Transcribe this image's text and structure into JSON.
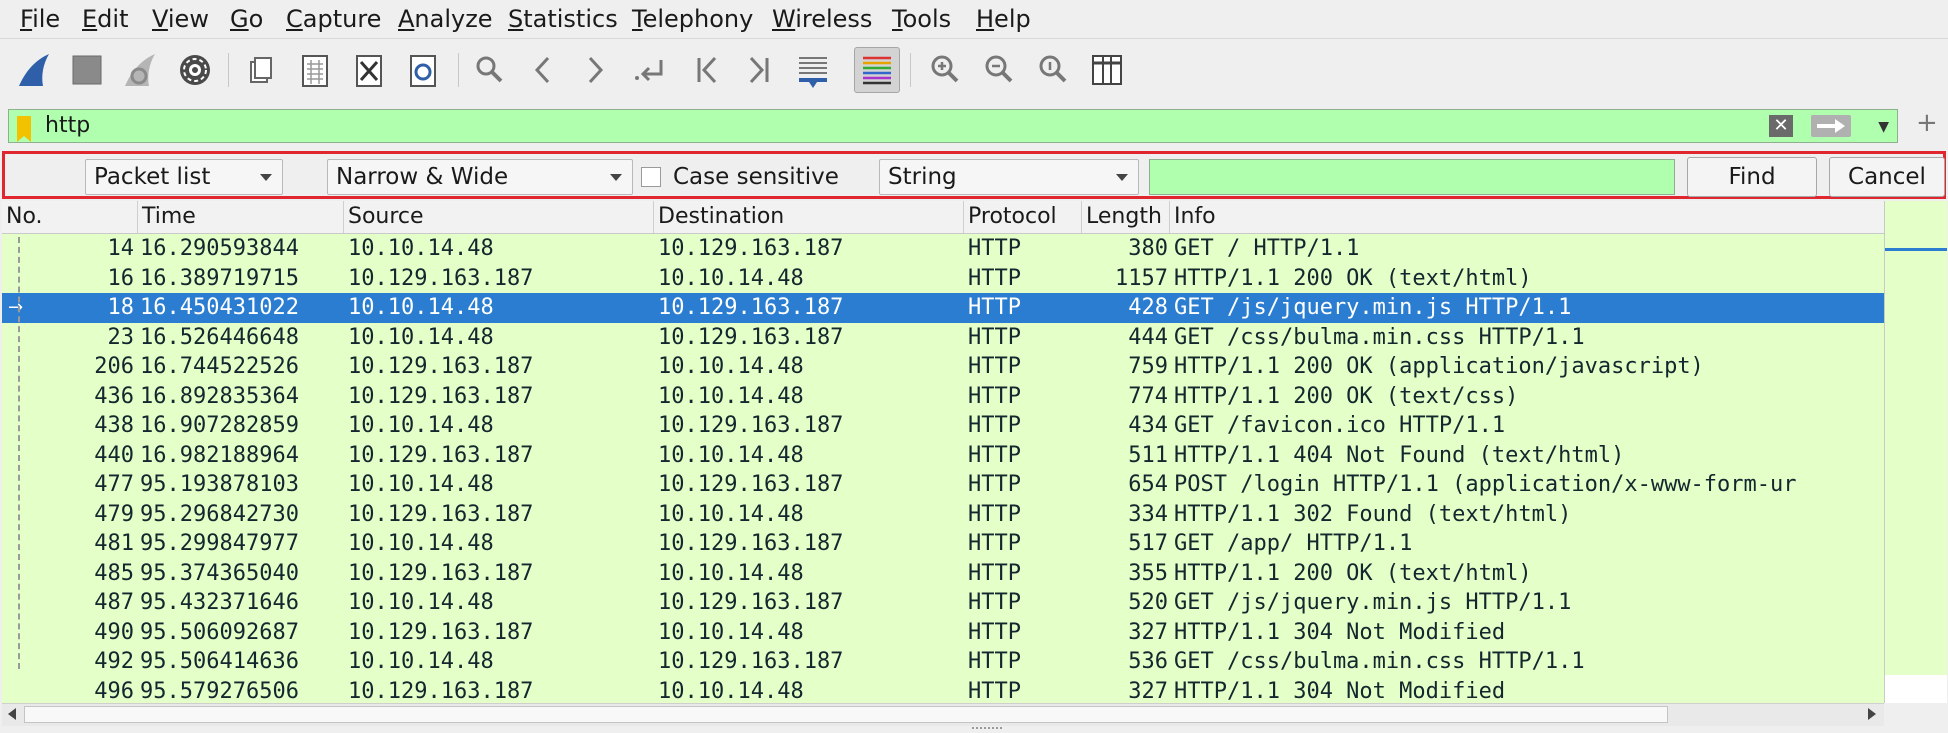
{
  "menu": [
    "File",
    "Edit",
    "View",
    "Go",
    "Capture",
    "Analyze",
    "Statistics",
    "Telephony",
    "Wireless",
    "Tools",
    "Help"
  ],
  "menu_mnemonic": [
    "F",
    "E",
    "V",
    "G",
    "C",
    "A",
    "S",
    "T",
    "W",
    "T",
    "H"
  ],
  "toolbar": [
    {
      "icon": "shark-fin-start-icon"
    },
    {
      "icon": "stop-capture-icon"
    },
    {
      "icon": "restart-capture-icon"
    },
    {
      "icon": "capture-options-gear-icon"
    },
    {
      "icon": "open-file-icon"
    },
    {
      "icon": "save-file-icon"
    },
    {
      "icon": "close-file-icon"
    },
    {
      "icon": "reload-file-icon"
    },
    {
      "icon": "find-packet-icon"
    },
    {
      "icon": "go-back-icon"
    },
    {
      "icon": "go-forward-icon"
    },
    {
      "icon": "go-to-packet-icon"
    },
    {
      "icon": "first-packet-icon"
    },
    {
      "icon": "last-packet-icon"
    },
    {
      "icon": "autoscroll-icon"
    },
    {
      "icon": "colorize-icon"
    },
    {
      "icon": "zoom-in-icon"
    },
    {
      "icon": "zoom-out-icon"
    },
    {
      "icon": "zoom-normal-icon"
    },
    {
      "icon": "resize-columns-icon"
    }
  ],
  "display_filter": {
    "value": "http",
    "clear_icon": "✕"
  },
  "find_bar": {
    "search_in": "Packet list",
    "char_width": "Narrow & Wide",
    "case_sensitive_label": "Case sensitive",
    "case_sensitive_checked": false,
    "search_type": "String",
    "search_value": "",
    "find_label": "Find",
    "cancel_label": "Cancel"
  },
  "columns": [
    "No.",
    "Time",
    "Source",
    "Destination",
    "Protocol",
    "Length",
    "Info"
  ],
  "selected_row": 2,
  "colors": {
    "row_bg": "#e4ffc7",
    "selected": "#2a7dd0",
    "filter_ok": "#afffaf",
    "find_border": "#e0262f"
  },
  "rows": [
    {
      "no": "14",
      "time": "16.290593844",
      "src": "10.10.14.48",
      "dst": "10.129.163.187",
      "proto": "HTTP",
      "len": "380",
      "info": "GET / HTTP/1.1"
    },
    {
      "no": "16",
      "time": "16.389719715",
      "src": "10.129.163.187",
      "dst": "10.10.14.48",
      "proto": "HTTP",
      "len": "1157",
      "info": "HTTP/1.1 200 OK  (text/html)"
    },
    {
      "no": "18",
      "time": "16.450431022",
      "src": "10.10.14.48",
      "dst": "10.129.163.187",
      "proto": "HTTP",
      "len": "428",
      "info": "GET /js/jquery.min.js HTTP/1.1"
    },
    {
      "no": "23",
      "time": "16.526446648",
      "src": "10.10.14.48",
      "dst": "10.129.163.187",
      "proto": "HTTP",
      "len": "444",
      "info": "GET /css/bulma.min.css HTTP/1.1"
    },
    {
      "no": "206",
      "time": "16.744522526",
      "src": "10.129.163.187",
      "dst": "10.10.14.48",
      "proto": "HTTP",
      "len": "759",
      "info": "HTTP/1.1 200 OK  (application/javascript)"
    },
    {
      "no": "436",
      "time": "16.892835364",
      "src": "10.129.163.187",
      "dst": "10.10.14.48",
      "proto": "HTTP",
      "len": "774",
      "info": "HTTP/1.1 200 OK  (text/css)"
    },
    {
      "no": "438",
      "time": "16.907282859",
      "src": "10.10.14.48",
      "dst": "10.129.163.187",
      "proto": "HTTP",
      "len": "434",
      "info": "GET /favicon.ico HTTP/1.1"
    },
    {
      "no": "440",
      "time": "16.982188964",
      "src": "10.129.163.187",
      "dst": "10.10.14.48",
      "proto": "HTTP",
      "len": "511",
      "info": "HTTP/1.1 404 Not Found  (text/html)"
    },
    {
      "no": "477",
      "time": "95.193878103",
      "src": "10.10.14.48",
      "dst": "10.129.163.187",
      "proto": "HTTP",
      "len": "654",
      "info": "POST /login HTTP/1.1  (application/x-www-form-ur"
    },
    {
      "no": "479",
      "time": "95.296842730",
      "src": "10.129.163.187",
      "dst": "10.10.14.48",
      "proto": "HTTP",
      "len": "334",
      "info": "HTTP/1.1 302 Found  (text/html)"
    },
    {
      "no": "481",
      "time": "95.299847977",
      "src": "10.10.14.48",
      "dst": "10.129.163.187",
      "proto": "HTTP",
      "len": "517",
      "info": "GET /app/ HTTP/1.1"
    },
    {
      "no": "485",
      "time": "95.374365040",
      "src": "10.129.163.187",
      "dst": "10.10.14.48",
      "proto": "HTTP",
      "len": "355",
      "info": "HTTP/1.1 200 OK  (text/html)"
    },
    {
      "no": "487",
      "time": "95.432371646",
      "src": "10.10.14.48",
      "dst": "10.129.163.187",
      "proto": "HTTP",
      "len": "520",
      "info": "GET /js/jquery.min.js HTTP/1.1"
    },
    {
      "no": "490",
      "time": "95.506092687",
      "src": "10.129.163.187",
      "dst": "10.10.14.48",
      "proto": "HTTP",
      "len": "327",
      "info": "HTTP/1.1 304 Not Modified"
    },
    {
      "no": "492",
      "time": "95.506414636",
      "src": "10.10.14.48",
      "dst": "10.129.163.187",
      "proto": "HTTP",
      "len": "536",
      "info": "GET /css/bulma.min.css HTTP/1.1"
    },
    {
      "no": "496",
      "time": "95.579276506",
      "src": "10.129.163.187",
      "dst": "10.10.14.48",
      "proto": "HTTP",
      "len": "327",
      "info": "HTTP/1.1 304 Not Modified"
    }
  ]
}
